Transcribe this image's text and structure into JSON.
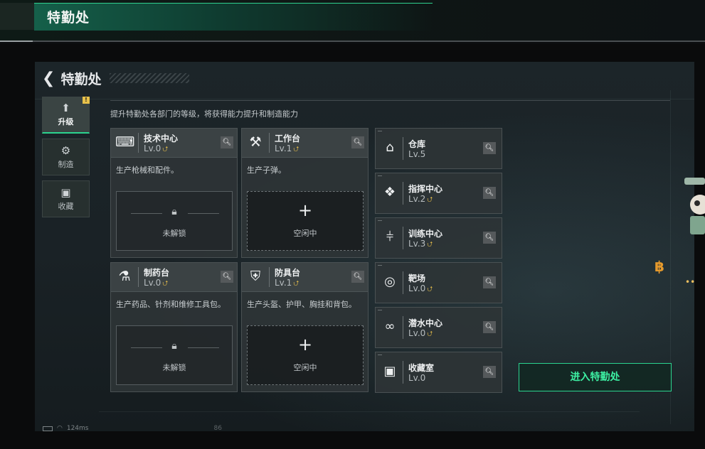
{
  "header": {
    "title": "特勤处"
  },
  "window": {
    "back_label": "特勤处",
    "description": "提升特勤处各部门的等级，将获得能力提升和制造能力"
  },
  "tabs": [
    {
      "label": "升级",
      "icon": "upgrade-icon",
      "active": true,
      "badge": "!"
    },
    {
      "label": "制造",
      "icon": "gears-icon",
      "active": false
    },
    {
      "label": "收藏",
      "icon": "collection-icon",
      "active": false
    }
  ],
  "departments": [
    {
      "name": "技术中心",
      "level": "Lv.0",
      "icon": "tech-center-icon",
      "desc": "生产枪械和配件。",
      "slot_state": "未解锁",
      "locked": true
    },
    {
      "name": "工作台",
      "level": "Lv.1",
      "icon": "workbench-icon",
      "desc": "生产子弹。",
      "slot_state": "空闲中",
      "locked": false
    },
    {
      "name": "制药台",
      "level": "Lv.0",
      "icon": "pharmacy-icon",
      "desc": "生产药品、针剂和维修工具包。",
      "slot_state": "未解锁",
      "locked": true
    },
    {
      "name": "防具台",
      "level": "Lv.1",
      "icon": "armor-bench-icon",
      "desc": "生产头盔、护甲、胸挂和背包。",
      "slot_state": "空闲中",
      "locked": false
    }
  ],
  "facilities": [
    {
      "name": "仓库",
      "level": "Lv.5",
      "icon": "warehouse-icon",
      "upgradable": false
    },
    {
      "name": "指挥中心",
      "level": "Lv.2",
      "icon": "command-center-icon",
      "upgradable": true
    },
    {
      "name": "训练中心",
      "level": "Lv.3",
      "icon": "training-center-icon",
      "upgradable": true
    },
    {
      "name": "靶场",
      "level": "Lv.0",
      "icon": "shooting-range-icon",
      "upgradable": true
    },
    {
      "name": "潜水中心",
      "level": "Lv.0",
      "icon": "diving-center-icon",
      "upgradable": true
    },
    {
      "name": "收藏室",
      "level": "Lv.0",
      "icon": "collection-room-icon",
      "upgradable": false
    }
  ],
  "enter_button": "进入特勤处",
  "status_bar": {
    "ping": "124ms",
    "page_number": "86"
  },
  "colors": {
    "accent": "#2bd48f",
    "upgrade": "#d9b44a"
  }
}
